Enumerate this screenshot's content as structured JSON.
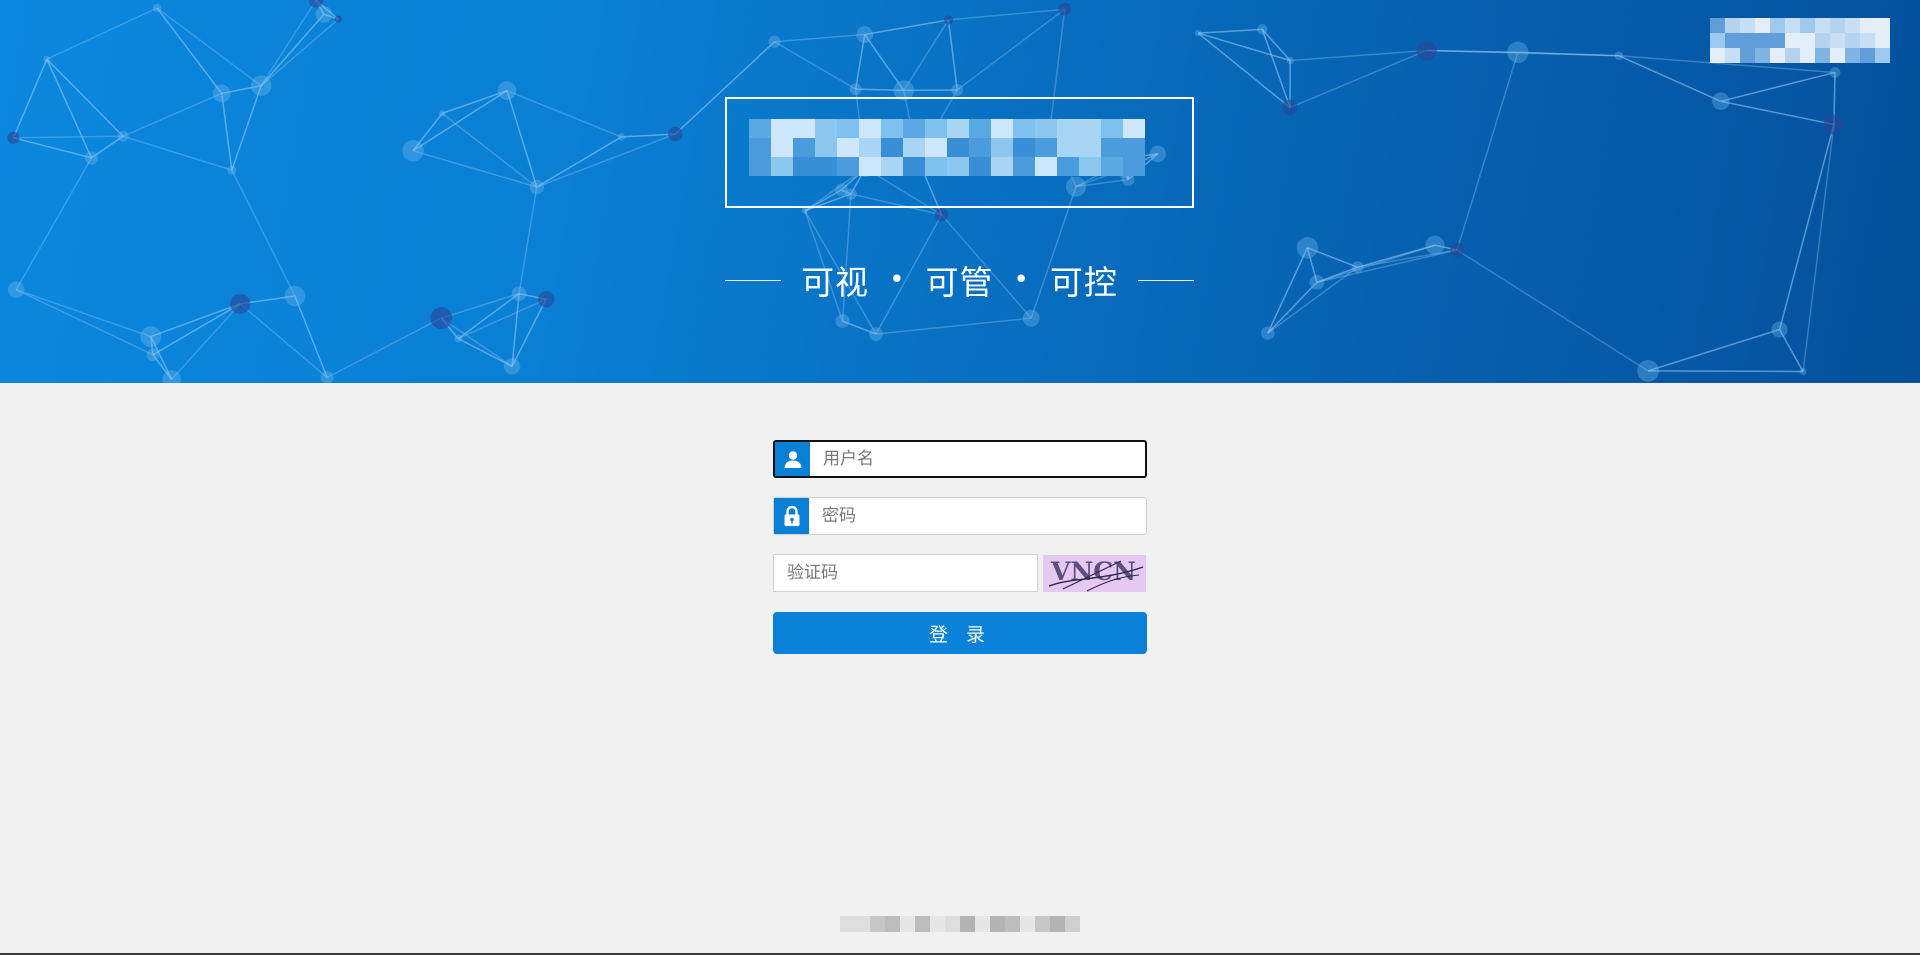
{
  "banner": {
    "slogan": {
      "word1": "可视",
      "word2": "可管",
      "word3": "可控",
      "separator": "•"
    }
  },
  "login_form": {
    "username": {
      "placeholder": "用户名",
      "value": ""
    },
    "password": {
      "placeholder": "密码",
      "value": ""
    },
    "captcha": {
      "placeholder": "验证码",
      "value": "",
      "image_code": "VNCN"
    },
    "submit_label": "登 录"
  },
  "icons": {
    "username": "user-icon",
    "password": "lock-icon"
  },
  "colors": {
    "banner_start": "#0a87de",
    "banner_end": "#04509c",
    "accent": "#0a82da",
    "page_background": "#f1f1f1",
    "captcha_background": "#e6c9f2"
  }
}
